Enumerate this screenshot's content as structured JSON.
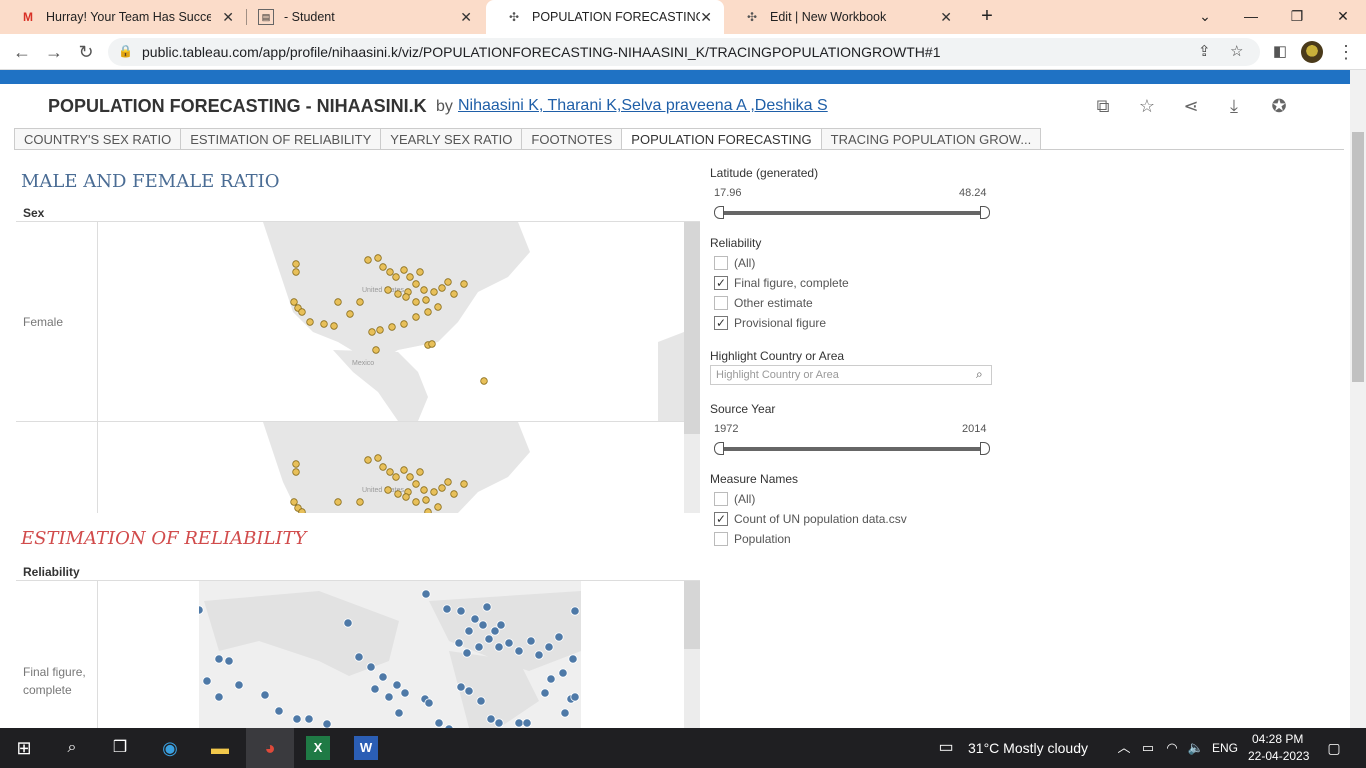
{
  "browser": {
    "tabs": [
      {
        "title": "Hurray! Your Team Has Successfu",
        "icon": "gmail-icon"
      },
      {
        "title": "- Student",
        "icon": "document-icon"
      },
      {
        "title": "POPULATION FORECASTING - NI",
        "icon": "tableau-icon"
      },
      {
        "title": "Edit | New Workbook",
        "icon": "tableau-icon"
      }
    ],
    "url": "public.tableau.com/app/profile/nihaasini.k/viz/POPULATIONFORECASTING-NIHAASINI_K/TRACINGPOPULATIONGROWTH#1"
  },
  "viz": {
    "title": "POPULATION FORECASTING - NIHAASINI.K",
    "by": "by",
    "authors": "Nihaasini K, Tharani K,Selva praveena A ,Deshika S",
    "tabs": [
      "COUNTRY'S SEX RATIO",
      "ESTIMATION OF RELIABILITY",
      "YEARLY SEX RATIO",
      "FOOTNOTES",
      "POPULATION FORECASTING",
      "TRACING POPULATION GROW..."
    ],
    "active_tab": 4
  },
  "sheets": {
    "sheet1": {
      "title": "MALE AND FEMALE RATIO",
      "field": "Sex",
      "row_label": "Female",
      "map_labels": [
        "United States",
        "Mexico"
      ],
      "color": "#e8c05a"
    },
    "sheet2": {
      "title": "ESTIMATION OF RELIABILITY",
      "field": "Reliability",
      "row_label": "Final figure, complete",
      "color": "#4e79a7"
    }
  },
  "filters": {
    "latitude": {
      "label": "Latitude (generated)",
      "min": "17.96",
      "max": "48.24"
    },
    "reliability": {
      "label": "Reliability",
      "options": [
        {
          "label": "(All)",
          "checked": false
        },
        {
          "label": "Final figure, complete",
          "checked": true
        },
        {
          "label": "Other estimate",
          "checked": false
        },
        {
          "label": "Provisional figure",
          "checked": true
        }
      ]
    },
    "highlight": {
      "label": "Highlight Country or Area",
      "placeholder": "Highlight Country or Area"
    },
    "source_year": {
      "label": "Source Year",
      "min": "1972",
      "max": "2014"
    },
    "measure_names": {
      "label": "Measure Names",
      "options": [
        {
          "label": "(All)",
          "checked": false
        },
        {
          "label": "Count of UN population data.csv",
          "checked": true
        },
        {
          "label": "Population",
          "checked": false
        }
      ]
    }
  },
  "taskbar": {
    "weather": "31°C  Mostly cloudy",
    "lang": "ENG",
    "time": "04:28 PM",
    "date": "22-04-2023"
  }
}
